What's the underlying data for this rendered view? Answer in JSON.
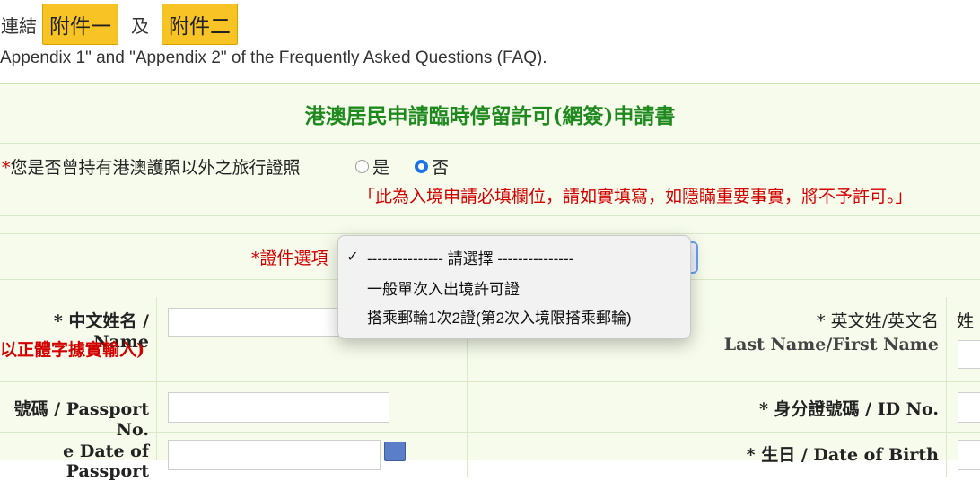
{
  "links": {
    "prefix": "連結",
    "appendix1": "附件一",
    "and": "及",
    "appendix2": "附件二",
    "english_line": "Appendix 1\" and \"Appendix 2\" of the Frequently Asked Questions (FAQ)."
  },
  "form": {
    "title": "港澳居民申請臨時停留許可(網簽)申請書",
    "travel_question": {
      "required_mark": "*",
      "label": "您是否曾持有港澳護照以外之旅行證照",
      "options": [
        {
          "label": "是",
          "selected": false
        },
        {
          "label": "否",
          "selected": true
        }
      ],
      "warning": "「此為入境申請必填欄位，請如實填寫，如隱瞞重要事實，將不予許可。」"
    },
    "document_option": {
      "label": "*證件選項",
      "dropdown_options": [
        {
          "label": "--------------- 請選擇 ---------------",
          "checked": true
        },
        {
          "label": "一般單次入出境許可證",
          "checked": false
        },
        {
          "label": "搭乘郵輪1次2證(第2次入境限搭乘郵輪)",
          "checked": false
        }
      ]
    },
    "fields": {
      "chinese_name_label": "* 中文姓名 / Name",
      "chinese_name_hint": "以正體字據實輸入)",
      "english_name_label": "* 英文姓/英文名",
      "english_name_sub": "Last Name/First Name",
      "surname_short": "姓",
      "passport_no_label": "號碼 / Passport No.",
      "id_no_label": "* 身分證號碼 / ID No.",
      "passport_date_label": "e Date of Passport",
      "dob_label": "* 生日 / Date of Birth"
    }
  },
  "icons": {
    "checkmark": "check-icon",
    "calendar": "calendar-icon"
  }
}
